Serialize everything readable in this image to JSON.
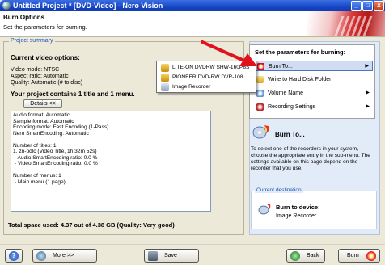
{
  "window": {
    "title": "Untitled Project * [DVD-Video] - Nero Vision",
    "buttons": {
      "minimize": "_",
      "maximize": "□",
      "close": "x"
    }
  },
  "header": {
    "title": "Burn Options",
    "subtitle": "Set the parameters for burning."
  },
  "summary": {
    "legend": "Project summary",
    "current_options_heading": "Current video options:",
    "video_options": [
      "Video mode: NTSC",
      "Aspect ratio: Automatic",
      "Quality: Automatic (# to disc)"
    ],
    "contains": "Your project contains 1 title and 1 menu.",
    "details_button": "Details <<",
    "details_lines": [
      "Audio format: Automatic",
      "Sample format: Automatic",
      "Encoding mode: Fast Encoding (1-Pass)",
      "Nero SmartEncoding: Automatic",
      "",
      "Number of titles: 1",
      "1. zn-pdlc (Video Title, 1h 32m 52s)",
      " - Audio SmartEncoding ratio: 0.0 %",
      " - Video SmartEncoding ratio: 0.0 %",
      "",
      "Number of menus: 1",
      " - Main menu (1 page)"
    ],
    "total_space": "Total space used: 4.37 out of 4.38 GB (Quality: Very good)"
  },
  "params_menu": {
    "title": "Set the parameters for burning:",
    "items": [
      {
        "label": "Burn To...",
        "icon": "burn-icon",
        "has_submenu": true,
        "selected": true
      },
      {
        "label": "Write to Hard Disk Folder",
        "icon": "folder-icon",
        "has_submenu": false,
        "selected": false
      },
      {
        "label": "Volume Name",
        "icon": "volume-icon",
        "has_submenu": true,
        "selected": false
      },
      {
        "label": "Recording Settings",
        "icon": "settings-icon",
        "has_submenu": true,
        "selected": false
      }
    ]
  },
  "submenu": {
    "items": [
      {
        "label": "LITE-ON  DVDRW SHW-160P6S",
        "icon": "drive-icon"
      },
      {
        "label": "PIONEER  DVD-RW  DVR-108",
        "icon": "drive-icon"
      },
      {
        "label": "Image Recorder",
        "icon": "image-recorder-icon"
      }
    ]
  },
  "burnto": {
    "heading": "Burn To...",
    "description": "To select one of the recorders in your system, choose the appropriate entry in the sub-menu. The settings available on this page depend on the recorder that you use."
  },
  "current_destination": {
    "legend": "Current destination",
    "title": "Burn to device:",
    "value": "Image Recorder"
  },
  "bottom": {
    "help": "?",
    "more": "More >>",
    "save": "Save",
    "back": "Back",
    "burn": "Burn"
  },
  "colors": {
    "accent_blue": "#1c4fb8",
    "arrow_red": "#e0121c",
    "title_bar": "#1747c9"
  }
}
